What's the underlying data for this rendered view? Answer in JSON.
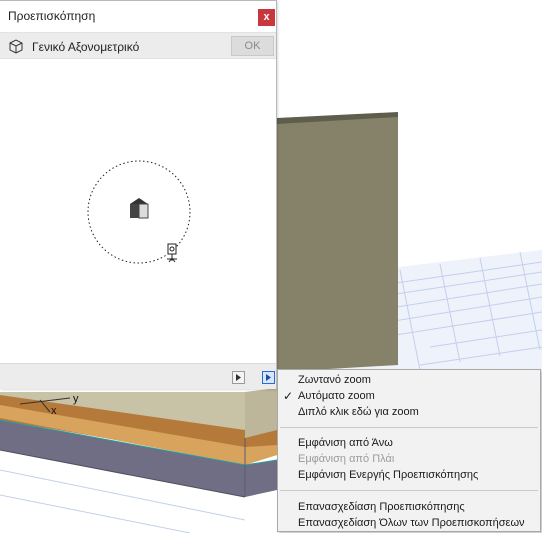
{
  "palette": {
    "title": "Προεπισκόπηση",
    "close_label": "x",
    "view": {
      "name": "Γενικό Αξονομετρικό",
      "ok_label": "OK",
      "icon": "cube-icon"
    }
  },
  "scene": {
    "axis_y_label": "y",
    "axis_x_label": "x",
    "wall_color": "#86826a",
    "floor_color": "#6f6e84",
    "grid_color": "#b8c6e6",
    "trim_color": "#b57a3a"
  },
  "context_menu": {
    "items": [
      {
        "label": "Ζωντανό zoom",
        "checked": false,
        "enabled": true
      },
      {
        "label": "Αυτόματο zoom",
        "checked": true,
        "enabled": true
      },
      {
        "label": "Διπλό κλικ εδώ για zoom",
        "checked": false,
        "enabled": true
      },
      {
        "label": "Εμφάνιση από Άνω",
        "checked": false,
        "enabled": true
      },
      {
        "label": "Εμφάνιση από Πλάι",
        "checked": false,
        "enabled": false
      },
      {
        "label": "Εμφάνιση Ενεργής Προεπισκόπησης",
        "checked": false,
        "enabled": true
      },
      {
        "label": "Επανασχεδίαση Προεπισκόπησης",
        "checked": false,
        "enabled": true
      },
      {
        "label": "Επανασχεδίαση Όλων των Προεπισκοπήσεων",
        "checked": false,
        "enabled": true
      }
    ],
    "check_glyph": "✓"
  }
}
